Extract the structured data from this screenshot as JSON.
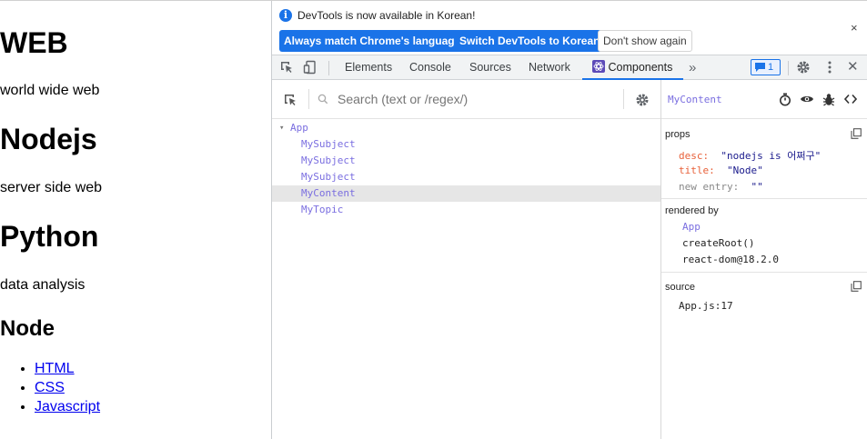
{
  "page": {
    "h1_web": "WEB",
    "p_web": "world wide web",
    "h1_nodejs": "Nodejs",
    "p_nodejs": "server side web",
    "h1_python": "Python",
    "p_python": "data analysis",
    "h2_node": "Node",
    "links": [
      "HTML",
      "CSS",
      "Javascript"
    ]
  },
  "devtools": {
    "infobar": {
      "message": "DevTools is now available in Korean!",
      "btn_match": "Always match Chrome's language",
      "btn_switch": "Switch DevTools to Korean",
      "btn_dont": "Don't show again",
      "close": "×"
    },
    "tabs": [
      "Elements",
      "Console",
      "Sources",
      "Network",
      "Components"
    ],
    "more": "»",
    "issues_count": "1",
    "close": "✕",
    "search_placeholder": "Search (text or /regex/)",
    "tree": [
      {
        "label": "App",
        "expanded": true
      },
      {
        "label": "MySubject"
      },
      {
        "label": "MySubject"
      },
      {
        "label": "MySubject"
      },
      {
        "label": "MyContent",
        "selected": true
      },
      {
        "label": "MyTopic"
      }
    ],
    "tree_arrow": "▾",
    "selected_component": "MyContent",
    "props_title": "props",
    "props": [
      {
        "key": "desc",
        "sep": ":",
        "value": "\"nodejs is 어쩌구\""
      },
      {
        "key": "title",
        "sep": ":",
        "value": "\"Node\""
      },
      {
        "key": "new entry",
        "sep": ":",
        "value": "\"\""
      }
    ],
    "rendered_by_title": "rendered by",
    "rendered_by": [
      "App",
      "createRoot()",
      "react-dom@18.2.0"
    ],
    "source_title": "source",
    "source": "App.js:17"
  },
  "colors": {
    "accent": "#1a73e8",
    "component": "#7a6ee0",
    "prop_key": "#e8613a",
    "prop_string": "#1a1a8c"
  }
}
